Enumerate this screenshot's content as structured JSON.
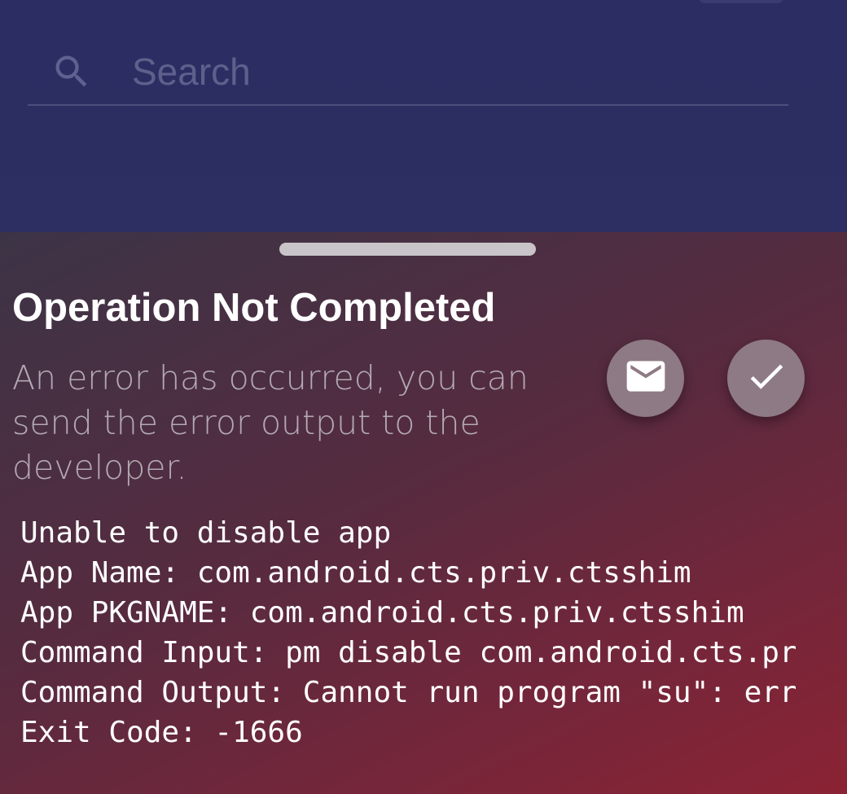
{
  "search": {
    "placeholder": "Search",
    "icon": "search-icon"
  },
  "dialog": {
    "title": "Operation Not Completed",
    "message": "An error has occurred, you can send the error output to the developer.",
    "actions": {
      "send_icon": "mail-icon",
      "confirm_icon": "check-icon"
    },
    "output_lines": [
      "Unable to disable app",
      "App Name: com.android.cts.priv.ctsshim",
      "App PKGNAME: com.android.cts.priv.ctsshim",
      "Command Input: pm disable com.android.cts.pr",
      "Command Output: Cannot run program \"su\": err",
      "Exit Code: -1666"
    ]
  },
  "colors": {
    "header_bg": "#2b2d63",
    "sheet_gradient_start": "#3c3446",
    "sheet_gradient_end": "#8a2334",
    "fab_bg": "#8e7a85"
  }
}
